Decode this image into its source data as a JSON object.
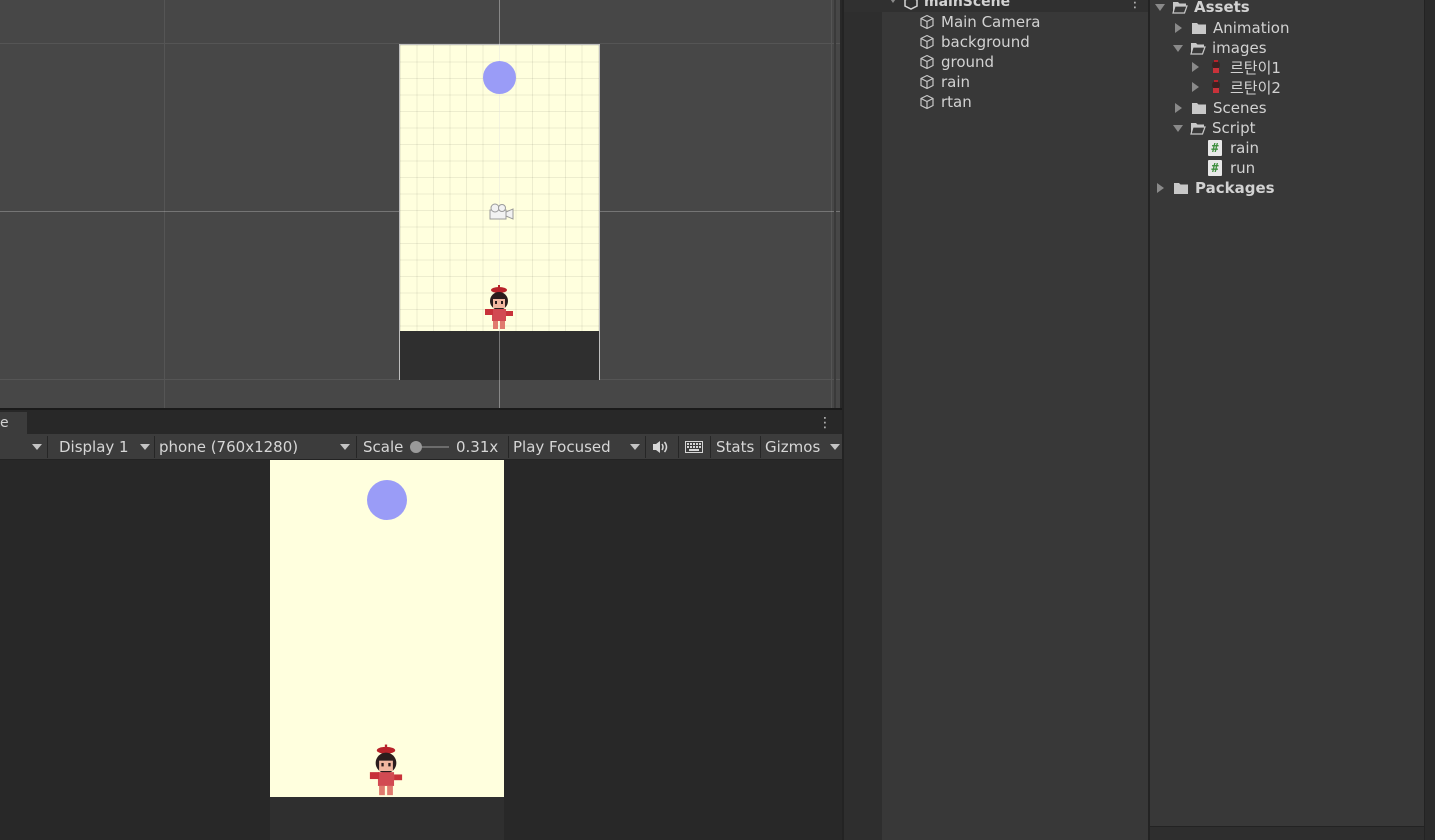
{
  "game_view": {
    "tab_label": "e",
    "menu_glyph": "⋮",
    "display_label": "Display 1",
    "resolution_label": "phone (760x1280)",
    "scale_label": "Scale",
    "scale_value": "0.31x",
    "play_mode_label": "Play Focused",
    "stats_label": "Stats",
    "gizmos_label": "Gizmos"
  },
  "hierarchy": {
    "scene_name": "mainScene",
    "menu_glyph": "⋮",
    "items": [
      {
        "label": "Main Camera"
      },
      {
        "label": "background"
      },
      {
        "label": "ground"
      },
      {
        "label": "rain"
      },
      {
        "label": "rtan"
      }
    ]
  },
  "project": {
    "tree": [
      {
        "label": "Assets",
        "bold": true
      },
      {
        "label": "Animation"
      },
      {
        "label": "images"
      },
      {
        "label": "르탄이1"
      },
      {
        "label": "르탄이2"
      },
      {
        "label": "Scenes"
      },
      {
        "label": "Script"
      },
      {
        "label": "rain"
      },
      {
        "label": "run"
      },
      {
        "label": "Packages",
        "bold": true
      }
    ],
    "script_icon_glyph": "#"
  },
  "colors": {
    "background_sprite": "#ffffde",
    "rain_sprite": "#9a9cf7",
    "ground_sprite": "#2f2f2f"
  }
}
